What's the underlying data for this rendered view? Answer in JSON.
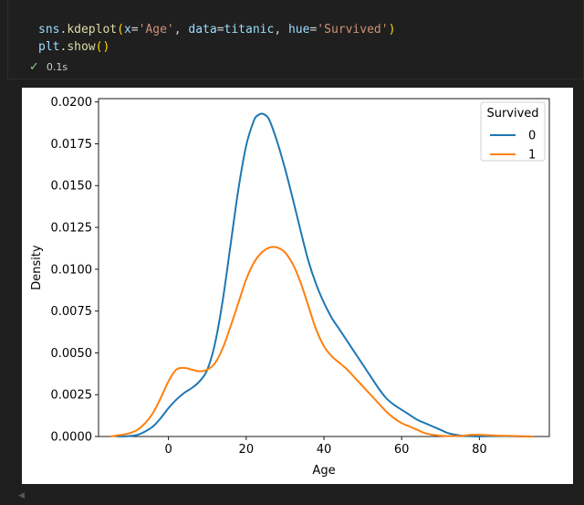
{
  "cell": {
    "code_line1": {
      "t1": "sns",
      "t2": ".",
      "t3": "kdeplot",
      "t4": "(",
      "t5": "x",
      "t6": "=",
      "t7": "'Age'",
      "t8": ", ",
      "t9": "data",
      "t10": "=",
      "t11": "titanic",
      "t12": ", ",
      "t13": "hue",
      "t14": "=",
      "t15": "'Survived'",
      "t16": ")"
    },
    "code_line2": {
      "t1": "plt",
      "t2": ".",
      "t3": "show",
      "t4": "()"
    },
    "status_icon": "check-icon",
    "exec_time": "0.1s"
  },
  "colors": {
    "series_0": "#1f77b4",
    "series_1": "#ff7f0e",
    "check": "#89d185"
  },
  "chart_data": {
    "type": "line",
    "xlabel": "Age",
    "ylabel": "Density",
    "xlim": [
      -18,
      98
    ],
    "ylim": [
      0,
      0.0202
    ],
    "xticks": [
      0,
      20,
      40,
      60,
      80
    ],
    "yticks": [
      "0.0000",
      "0.0025",
      "0.0050",
      "0.0075",
      "0.0100",
      "0.0125",
      "0.0150",
      "0.0175",
      "0.0200"
    ],
    "grid": false,
    "legend": {
      "title": "Survived",
      "position": "top-right"
    },
    "series": [
      {
        "name": "0",
        "x": [
          -13,
          -10,
          -8,
          -6,
          -4,
          -2,
          0,
          2,
          4,
          6,
          8,
          10,
          12,
          14,
          16,
          18,
          20,
          22,
          23,
          24,
          25,
          26,
          28,
          30,
          32,
          34,
          36,
          38,
          40,
          42,
          44,
          46,
          48,
          50,
          52,
          54,
          56,
          58,
          60,
          62,
          64,
          66,
          68,
          70,
          72,
          74,
          76,
          78,
          80,
          85,
          90,
          94
        ],
        "y": [
          0.0,
          3e-05,
          0.0001,
          0.0003,
          0.0006,
          0.0011,
          0.0017,
          0.0022,
          0.0026,
          0.0029,
          0.0033,
          0.004,
          0.0056,
          0.0082,
          0.0115,
          0.0148,
          0.0174,
          0.0189,
          0.0192,
          0.0193,
          0.0192,
          0.0189,
          0.0176,
          0.016,
          0.0142,
          0.0123,
          0.0105,
          0.0091,
          0.008,
          0.0071,
          0.0064,
          0.0057,
          0.005,
          0.0043,
          0.0036,
          0.0029,
          0.0023,
          0.0019,
          0.0016,
          0.0013,
          0.001,
          0.0008,
          0.0006,
          0.0004,
          0.0002,
          0.0001,
          3e-05,
          2e-05,
          1e-05,
          2e-05,
          1e-05,
          0.0
        ]
      },
      {
        "name": "1",
        "x": [
          -15,
          -12,
          -10,
          -8,
          -6,
          -4,
          -2,
          0,
          2,
          4,
          6,
          8,
          10,
          12,
          14,
          16,
          18,
          20,
          22,
          24,
          26,
          28,
          30,
          32,
          34,
          36,
          38,
          40,
          42,
          44,
          46,
          48,
          50,
          52,
          54,
          56,
          58,
          60,
          62,
          64,
          66,
          68,
          70,
          72,
          74,
          76,
          78,
          80,
          85,
          90,
          94
        ],
        "y": [
          0.0,
          0.0001,
          0.0002,
          0.0004,
          0.0008,
          0.0014,
          0.0023,
          0.0033,
          0.004,
          0.0041,
          0.004,
          0.0039,
          0.004,
          0.0044,
          0.0053,
          0.0066,
          0.008,
          0.0094,
          0.0104,
          0.011,
          0.0113,
          0.0113,
          0.011,
          0.0103,
          0.0092,
          0.0078,
          0.0064,
          0.0054,
          0.0048,
          0.0044,
          0.004,
          0.0035,
          0.003,
          0.0025,
          0.002,
          0.0015,
          0.0011,
          0.0008,
          0.0006,
          0.0004,
          0.0002,
          0.0001,
          5e-05,
          3e-05,
          3e-05,
          5e-05,
          0.0001,
          0.0001,
          5e-05,
          2e-05,
          0.0
        ]
      }
    ]
  }
}
